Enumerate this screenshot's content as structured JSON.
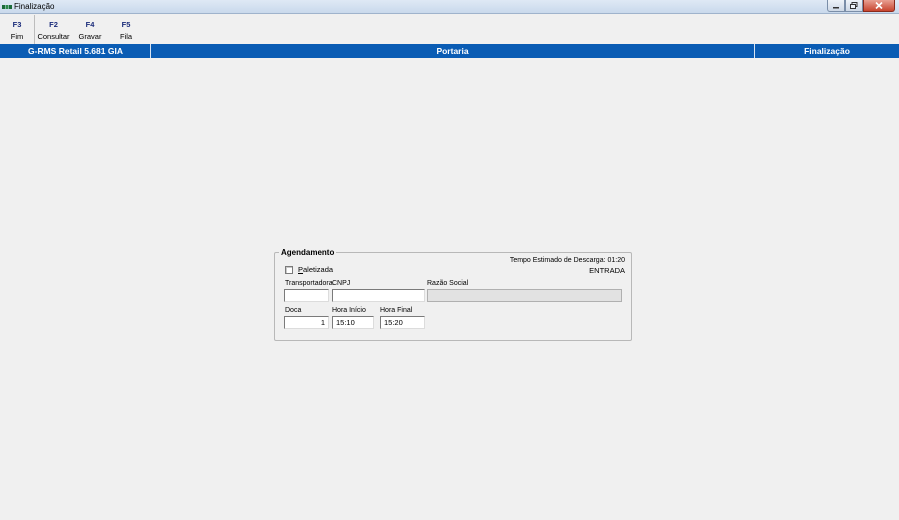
{
  "window": {
    "title": "Finalização"
  },
  "toolbar": [
    {
      "key": "F3",
      "label": "Fim"
    },
    {
      "key": "F2",
      "label": "Consultar"
    },
    {
      "key": "F4",
      "label": "Gravar"
    },
    {
      "key": "F5",
      "label": "Fila"
    }
  ],
  "header": {
    "system": "G-RMS Retail 5.681 GIA",
    "module": "Portaria",
    "screen": "Finalização"
  },
  "agendamento": {
    "legend": "Agendamento",
    "tempo_estimado": "Tempo Estimado de Descarga: 01:20",
    "tipo": "ENTRADA",
    "paletizada_label": "Paletizada",
    "paletizada_checked": false,
    "transportadora_label": "Transportadora",
    "transportadora_value": "",
    "cnpj_label": "CNPJ",
    "cnpj_value": "",
    "razao_social_label": "Razão Social",
    "razao_social_value": "",
    "doca_label": "Doca",
    "doca_value": "1",
    "hora_inicio_label": "Hora Início",
    "hora_inicio_value": "15:10",
    "hora_final_label": "Hora Final",
    "hora_final_value": "15:20"
  },
  "colors": {
    "header_bg": "#0a5cb4",
    "header_text": "#ffffff",
    "background": "#f0f0f0"
  }
}
